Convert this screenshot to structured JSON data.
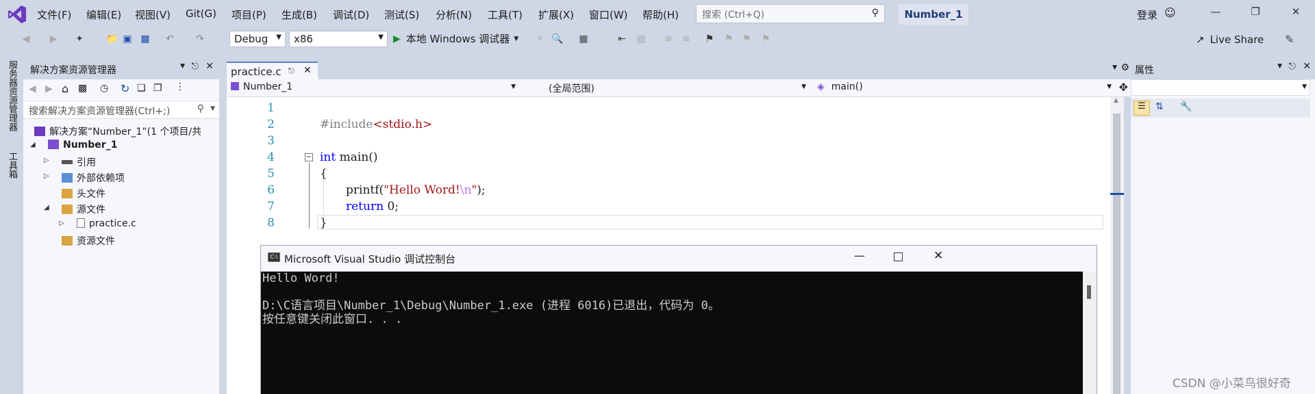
{
  "menubar": {
    "items": [
      "文件(F)",
      "编辑(E)",
      "视图(V)",
      "Git(G)",
      "项目(P)",
      "生成(B)",
      "调试(D)",
      "测试(S)",
      "分析(N)",
      "工具(T)",
      "扩展(X)",
      "窗口(W)",
      "帮助(H)"
    ],
    "search_placeholder": "搜索 (Ctrl+Q)",
    "solution_badge": "Number_1",
    "login": "登录"
  },
  "toolbar": {
    "config": "Debug",
    "platform": "x86",
    "run_label": "本地 Windows 调试器",
    "live_share": "Live Share"
  },
  "vstrip": {
    "server_explorer": "服务器资源管理器",
    "toolbox": "工具箱"
  },
  "solution_explorer": {
    "title": "解决方案资源管理器",
    "search_placeholder": "搜索解决方案资源管理器(Ctrl+;)",
    "solution": "解决方案“Number_1”(1 个项目/共",
    "project": "Number_1",
    "references": "引用",
    "external_deps": "外部依赖项",
    "header_files": "头文件",
    "source_files": "源文件",
    "practice_file": "practice.c",
    "resource_files": "资源文件"
  },
  "editor": {
    "tab": "practice.c",
    "nav_project": "Number_1",
    "nav_scope": "(全局范围)",
    "nav_member": "main()",
    "line_numbers": [
      "1",
      "2",
      "3",
      "4",
      "5",
      "6",
      "7",
      "8"
    ],
    "code": {
      "l2_directive": "#include",
      "l2_header": "<stdio.h>",
      "l4_keyword": "int",
      "l4_rest": " main()",
      "l5": "{",
      "l6_func": "printf(",
      "l6_str1": "\"Hello Word!",
      "l6_escape": "\\n",
      "l6_str2": "\"",
      "l6_end": ");",
      "l7_keyword": "return",
      "l7_rest": " 0;",
      "l8": "}"
    }
  },
  "properties": {
    "title": "属性"
  },
  "console": {
    "title": "Microsoft Visual Studio 调试控制台",
    "line1": "Hello Word!",
    "line2": "",
    "line3": "D:\\C语言项目\\Number_1\\Debug\\Number_1.exe (进程 6016)已退出，代码为 0。",
    "line4": "按任意键关闭此窗口. . ."
  },
  "watermark": "CSDN @小菜鸟很好奇",
  "colors": {
    "chrome": "#cfd6e5",
    "keyword": "#0000ff",
    "string": "#a31515",
    "escape": "#b776fb",
    "directive": "#808080",
    "line_number": "#2b91af",
    "console_bg": "#0c0c0c"
  }
}
